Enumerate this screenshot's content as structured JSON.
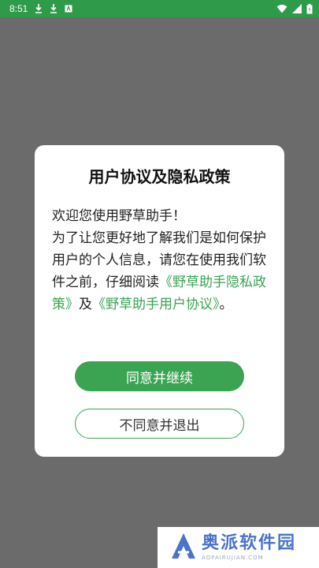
{
  "status_bar": {
    "time": "8:51",
    "icons": [
      "download-icon",
      "download-icon",
      "app-notification-icon",
      "wifi-icon",
      "signal-icon",
      "battery-icon"
    ]
  },
  "dialog": {
    "title": "用户协议及隐私政策",
    "body_text_1": "欢迎您使用野草助手！",
    "body_text_2": "为了让您更好地了解我们是如何保护用户的个人信息，请您在使用我们软件之前，仔细阅读",
    "privacy_link": "《野草助手隐私政策》",
    "connector": "及",
    "agreement_link": "《野草助手用户协议》",
    "ending": "。",
    "agree_button": "同意并继续",
    "disagree_button": "不同意并退出"
  },
  "watermark": {
    "name": "奥派软件园",
    "url": "AOPAIRUJIAN.COM"
  },
  "colors": {
    "accent": "#3aa452",
    "status_bar": "#2f9a4a",
    "overlay": "#6b6b6b",
    "watermark_text": "#4a73c9"
  }
}
